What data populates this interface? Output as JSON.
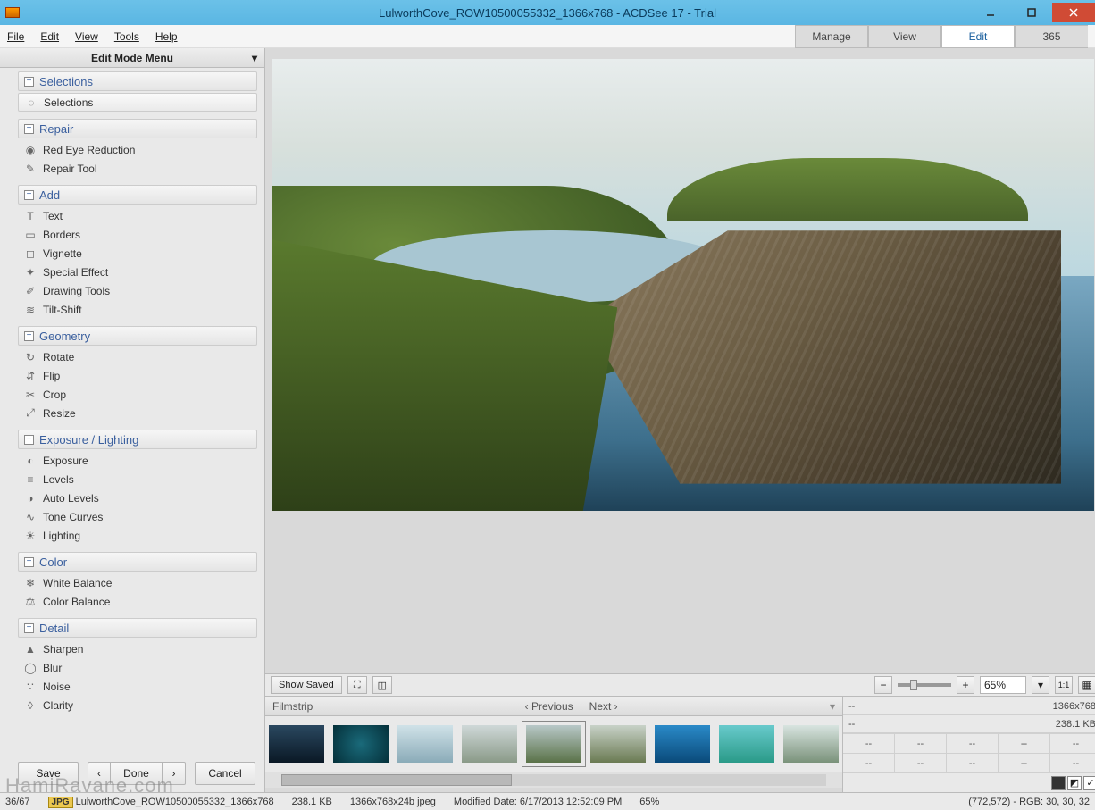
{
  "window": {
    "title": "LulworthCove_ROW10500055332_1366x768 - ACDSee 17 - Trial"
  },
  "menu": {
    "file": "File",
    "edit": "Edit",
    "view": "View",
    "tools": "Tools",
    "help": "Help"
  },
  "modes": {
    "manage": "Manage",
    "view": "View",
    "edit": "Edit",
    "three65": "365"
  },
  "sidebar": {
    "header": "Edit Mode Menu",
    "groups": [
      {
        "title": "Selections",
        "items": [
          "Selections"
        ]
      },
      {
        "title": "Repair",
        "items": [
          "Red Eye Reduction",
          "Repair Tool"
        ]
      },
      {
        "title": "Add",
        "items": [
          "Text",
          "Borders",
          "Vignette",
          "Special Effect",
          "Drawing Tools",
          "Tilt-Shift"
        ]
      },
      {
        "title": "Geometry",
        "items": [
          "Rotate",
          "Flip",
          "Crop",
          "Resize"
        ]
      },
      {
        "title": "Exposure / Lighting",
        "items": [
          "Exposure",
          "Levels",
          "Auto Levels",
          "Tone Curves",
          "Lighting"
        ]
      },
      {
        "title": "Color",
        "items": [
          "White Balance",
          "Color Balance"
        ]
      },
      {
        "title": "Detail",
        "items": [
          "Sharpen",
          "Blur",
          "Noise",
          "Clarity"
        ]
      }
    ]
  },
  "buttons": {
    "save": "Save",
    "done": "Done",
    "cancel": "Cancel"
  },
  "ubar": {
    "show_saved": "Show Saved",
    "zoom": "65%"
  },
  "filmstrip": {
    "label": "Filmstrip",
    "prev": "Previous",
    "next": "Next"
  },
  "info": {
    "dash1": "--",
    "dim": "1366x768",
    "dash2": "--",
    "size": "238.1 KB",
    "cells": [
      "--",
      "--",
      "--",
      "--",
      "--",
      "--",
      "--",
      "--",
      "--",
      "--"
    ]
  },
  "status": {
    "counter": "36/67",
    "badge": "JPG",
    "filename": "LulworthCove_ROW10500055332_1366x768",
    "filesize": "238.1 KB",
    "format": "1366x768x24b jpeg",
    "modified": "Modified Date: 6/17/2013 12:52:09 PM",
    "zoom": "65%",
    "pixel": "(772,572) - RGB: 30, 30, 32"
  },
  "watermark": "HamiRavane.com"
}
